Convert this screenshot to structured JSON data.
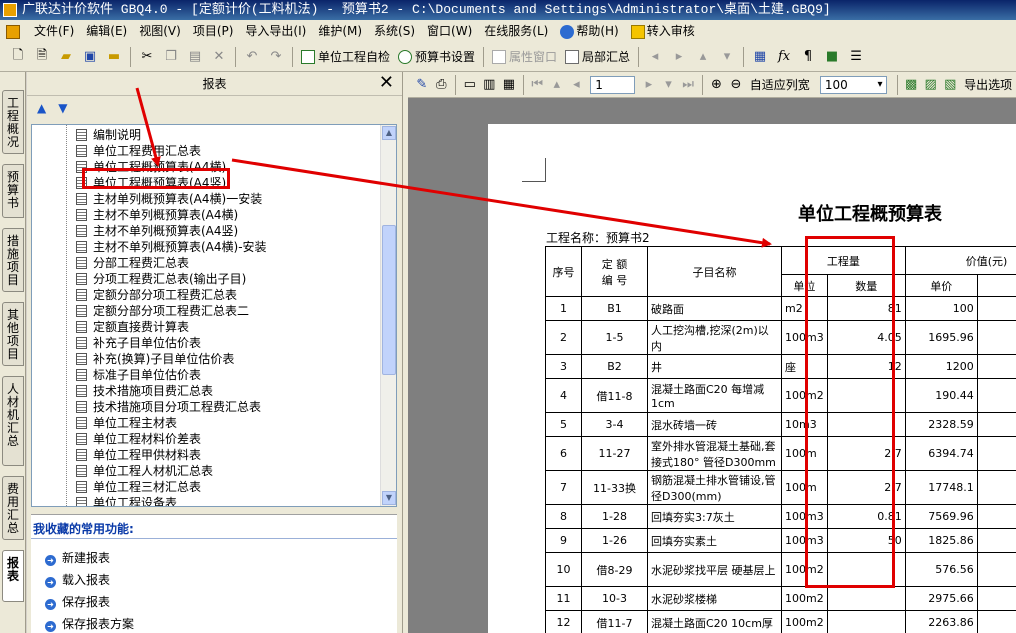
{
  "window": {
    "title": "广联达计价软件 GBQ4.0 - [定额计价(工料机法) - 预算书2 - C:\\Documents and Settings\\Administrator\\桌面\\土建.GBQ9]"
  },
  "menubar": {
    "items": [
      "文件(F)",
      "编辑(E)",
      "视图(V)",
      "项目(P)",
      "导入导出(I)",
      "维护(M)",
      "系统(S)",
      "窗口(W)",
      "在线服务(L)",
      "帮助(H)",
      "转入审核"
    ]
  },
  "toolbar1": {
    "unit_check": "单位工程自检",
    "budget_settings": "预算书设置",
    "property_window": "属性窗口",
    "partial_summary": "局部汇总"
  },
  "vtabs": [
    "工程概况",
    "预算书",
    "措施项目",
    "其他项目",
    "人材机汇总",
    "费用汇总",
    "报表"
  ],
  "panel": {
    "title": "报表",
    "close": "✕"
  },
  "tree": {
    "items": [
      "编制说明",
      "单位工程费用汇总表",
      "单位工程概预算表(A4横)",
      "单位工程概预算表(A4竖)",
      "主材单列概预算表(A4横)一安装",
      "主材不单列概预算表(A4横)",
      "主材不单列概预算表(A4竖)",
      "主材不单列概预算表(A4横)-安装",
      "分部工程费汇总表",
      "分项工程费汇总表(输出子目)",
      "定额分部分项工程费汇总表",
      "定额分部分项工程费汇总表二",
      "定额直接费计算表",
      "补充子目单位估价表",
      "补充(换算)子目单位估价表",
      "标准子目单位估价表",
      "技术措施项目费汇总表",
      "技术措施项目分项工程费汇总表",
      "单位工程主材表",
      "单位工程材料价差表",
      "单位工程甲供材料表",
      "单位工程人材机汇总表",
      "单位工程三材汇总表",
      "单位工程设备表"
    ]
  },
  "favorites": {
    "title": "我收藏的常用功能:",
    "items": [
      "新建报表",
      "载入报表",
      "保存报表",
      "保存报表方案"
    ]
  },
  "toolbar2": {
    "page": "1",
    "fit_width": "自适应列宽",
    "zoom": "100",
    "export": "导出选项"
  },
  "report": {
    "title": "单位工程概预算表",
    "project_name": "工程名称：预算书2",
    "headers": {
      "seq": "序号",
      "code": "定 额\n编 号",
      "name": "子目名称",
      "quantity_group": "工程量",
      "value_group": "价值(元)",
      "unit": "单位",
      "qty": "数量",
      "price": "单价",
      "total": "合"
    },
    "rows": [
      {
        "seq": "1",
        "code": "B1",
        "name": "破路面",
        "unit": "m2",
        "qty": "81",
        "price": "100"
      },
      {
        "seq": "2",
        "code": "1-5",
        "name": "人工挖沟槽,挖深(2m)以内",
        "unit": "100m3",
        "qty": "4.05",
        "price": "1695.96"
      },
      {
        "seq": "3",
        "code": "B2",
        "name": "井",
        "unit": "座",
        "qty": "12",
        "price": "1200"
      },
      {
        "seq": "4",
        "code": "借11-8",
        "name": "混凝土路面C20 每增减1cm",
        "unit": "100m2",
        "qty": "",
        "price": "190.44"
      },
      {
        "seq": "5",
        "code": "3-4",
        "name": "混水砖墙一砖",
        "unit": "10m3",
        "qty": "",
        "price": "2328.59"
      },
      {
        "seq": "6",
        "code": "11-27",
        "name": "室外排水管混凝土基础,套接式180° 管径D300mm",
        "unit": "100m",
        "qty": "2.7",
        "price": "6394.74"
      },
      {
        "seq": "7",
        "code": "11-33换",
        "name": "钢筋混凝土排水管铺设,管径D300(mm)",
        "unit": "100m",
        "qty": "2.7",
        "price": "17748.1"
      },
      {
        "seq": "8",
        "code": "1-28",
        "name": "回填夯实3:7灰土",
        "unit": "100m3",
        "qty": "0.81",
        "price": "7569.96"
      },
      {
        "seq": "9",
        "code": "1-26",
        "name": "回填夯实素土",
        "unit": "100m3",
        "qty": "50",
        "price": "1825.86"
      },
      {
        "seq": "10",
        "code": "借8-29",
        "name": "水泥砂浆找平层 硬基层上",
        "unit": "100m2",
        "qty": "",
        "price": "576.56"
      },
      {
        "seq": "11",
        "code": "10-3",
        "name": "水泥砂浆楼梯",
        "unit": "100m2",
        "qty": "",
        "price": "2975.66"
      },
      {
        "seq": "12",
        "code": "借11-7",
        "name": "混凝土路面C20 10cm厚",
        "unit": "100m2",
        "qty": "",
        "price": "2263.86"
      }
    ]
  },
  "colors": {
    "annotation_red": "#e00000",
    "title_blue": "#0a246a"
  }
}
